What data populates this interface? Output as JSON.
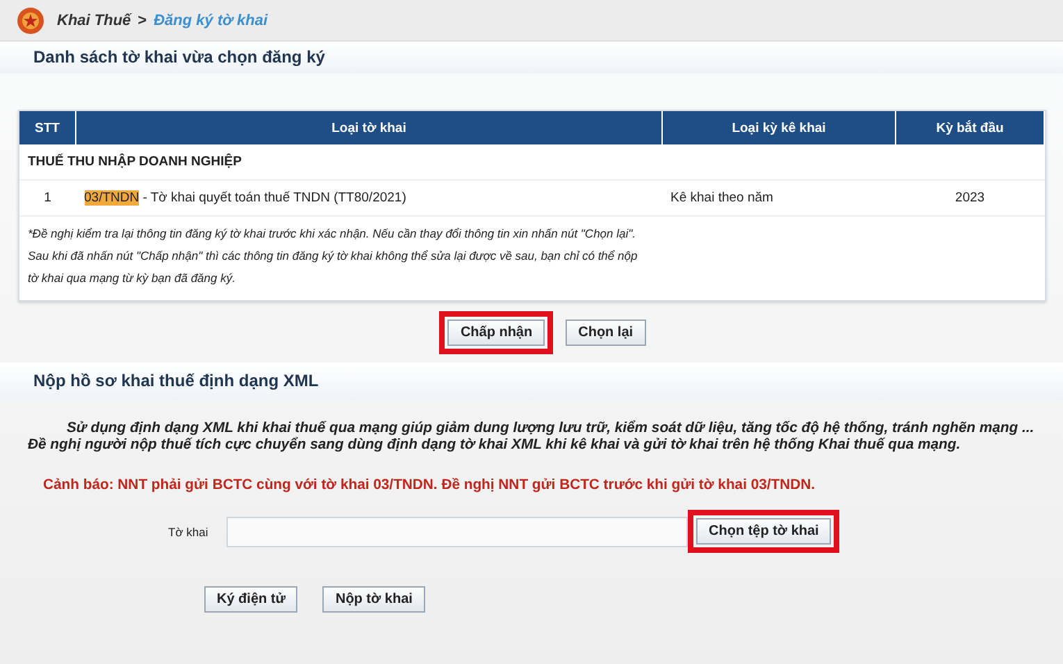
{
  "breadcrumb": {
    "root": "Khai Thuế",
    "separator": ">",
    "current": "Đăng ký tờ khai"
  },
  "register_section": {
    "title": "Danh sách tờ khai vừa chọn đăng ký",
    "table": {
      "columns": [
        "STT",
        "Loại tờ khai",
        "Loại kỳ kê khai",
        "Kỳ bắt đầu"
      ],
      "group": "THUẾ THU NHẬP DOANH NGHIỆP",
      "rows": [
        {
          "stt": "1",
          "code": "03/TNDN",
          "name": " - Tờ khai quyết toán thuế TNDN (TT80/2021)",
          "period": "Kê khai theo năm",
          "start": "2023"
        }
      ]
    },
    "notes": [
      "*Đề nghị kiểm tra lại thông tin đăng ký tờ khai trước khi xác nhận. Nếu cần thay đổi thông tin xin nhấn nút \"Chọn lại\".",
      "Sau khi đã nhấn nút \"Chấp nhận\" thì các thông tin đăng ký tờ khai không thể sửa lại được về sau, bạn chỉ có thể nộp",
      "tờ khai qua mạng từ kỳ bạn đã đăng ký."
    ],
    "buttons": [
      {
        "label": "Chấp nhận",
        "highlighted": true
      },
      {
        "label": "Chọn lại",
        "highlighted": false
      }
    ]
  },
  "xml_section": {
    "title": "Nộp hồ sơ khai thuế định dạng XML",
    "description": "Sử dụng định dạng XML khi khai thuế qua mạng giúp giảm dung lượng lưu trữ, kiểm soát dữ liệu, tăng tốc độ hệ thống, tránh nghẽn mạng ... Đề nghị người nộp thuế tích cực chuyển sang dùng định dạng tờ khai XML khi kê khai và gửi tờ khai trên hệ thống Khai thuế qua mạng.",
    "warning": "Cảnh báo: NNT phải gửi BCTC cùng với tờ khai 03/TNDN. Đề nghị NNT gửi BCTC trước khi gửi tờ khai 03/TNDN.",
    "file_label": "Tờ khai",
    "file_button": {
      "label": "Chọn tệp tờ khai",
      "highlighted": true
    },
    "buttons": [
      {
        "label": "Ký điện tử",
        "highlighted": false
      },
      {
        "label": "Nộp tờ khai",
        "highlighted": false
      }
    ]
  }
}
